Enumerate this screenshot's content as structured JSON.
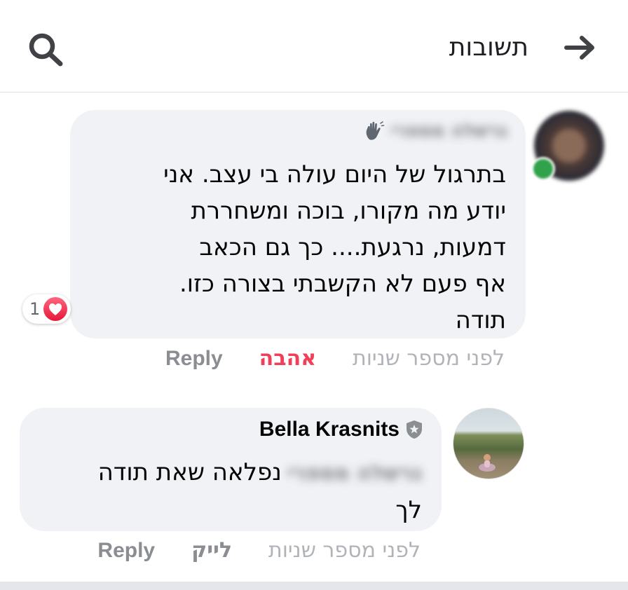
{
  "header": {
    "title": "תשובות",
    "back_icon": "arrow-right-icon",
    "search_icon": "search-icon"
  },
  "comments": [
    {
      "author_blurred": "גרשלה מספרי",
      "author_badge_icon": "waving-hand-icon",
      "text": "בתרגול של היום עולה בי עצב. אני\nיודע מה מקורו, בוכה ומשחררת\nדמעות, נרגעת.... כך גם הכאב\nאף פעם לא הקשבתי בצורה כזו.\nתודה",
      "reaction_count": "1",
      "reaction_icon": "heart-icon",
      "time": "לפני מספר שניות",
      "reaction_label": "אהבה",
      "reply_label": "Reply"
    },
    {
      "author": "Bella Krasnits",
      "author_badge_icon": "shield-star-icon",
      "mention_blurred": "גרשלה מספרי",
      "text": "נפלאה שאת תודה\nלך",
      "time": "לפני מספר שניות",
      "like_label": "לייק",
      "reply_label": "Reply"
    }
  ],
  "colors": {
    "bubble": "#f0f2f5",
    "love": "#f33e58",
    "secondary_text": "#8a8d91",
    "online": "#31a24c"
  }
}
